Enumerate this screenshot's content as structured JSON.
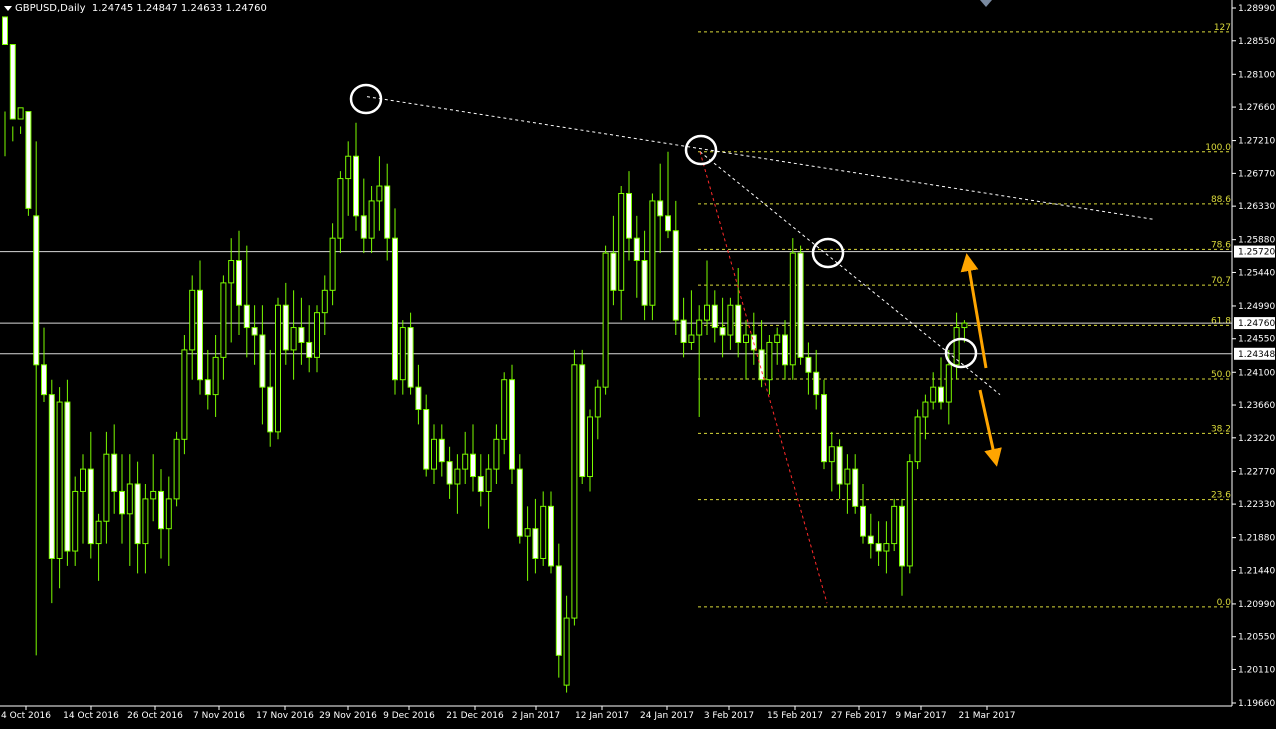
{
  "header": {
    "symbol_label": "GBPUSD,Daily",
    "ohlc": "1.24745 1.24847 1.24633 1.24760"
  },
  "colors": {
    "background": "#000000",
    "candle": "#7CFC00",
    "fib": "#d9d93a",
    "text": "#ffffff",
    "trend_red": "#ff2a2a",
    "arrow": "#ffa500",
    "price_box": "#ffffff"
  },
  "chart_data": {
    "type": "candlestick",
    "instrument": "GBPUSD",
    "timeframe": "Daily",
    "ylim": [
      1.1966,
      1.2899
    ],
    "y_ticks": [
      "1.28990",
      "1.28550",
      "1.28100",
      "1.27660",
      "1.27210",
      "1.26770",
      "1.26330",
      "1.25880",
      "1.25440",
      "1.24990",
      "1.24550",
      "1.24100",
      "1.23660",
      "1.23220",
      "1.22770",
      "1.22330",
      "1.21880",
      "1.21440",
      "1.20990",
      "1.20550",
      "1.20110",
      "1.19660"
    ],
    "x_ticks": [
      "4 Oct 2016",
      "14 Oct 2016",
      "26 Oct 2016",
      "7 Nov 2016",
      "17 Nov 2016",
      "29 Nov 2016",
      "9 Dec 2016",
      "21 Dec 2016",
      "2 Jan 2017",
      "12 Jan 2017",
      "24 Jan 2017",
      "3 Feb 2017",
      "15 Feb 2017",
      "27 Feb 2017",
      "9 Mar 2017",
      "21 Mar 2017"
    ],
    "horizontal_lines": [
      {
        "label": "1.25720",
        "price": 1.2572
      },
      {
        "label": "1.24760",
        "price": 1.2476
      },
      {
        "label": "1.24348",
        "price": 1.24348
      }
    ],
    "fibonacci": {
      "high": 1.2706,
      "low": 1.2095,
      "levels": [
        {
          "label": "127",
          "price": 1.2867
        },
        {
          "label": "100.0",
          "price": 1.2706
        },
        {
          "label": "88.6",
          "price": 1.2636
        },
        {
          "label": "78.6",
          "price": 1.2575
        },
        {
          "label": "70.7",
          "price": 1.2527
        },
        {
          "label": "61.8",
          "price": 1.2473
        },
        {
          "label": "50.0",
          "price": 1.2401
        },
        {
          "label": "38.2",
          "price": 1.2328
        },
        {
          "label": "23.6",
          "price": 1.2239
        },
        {
          "label": "0.0",
          "price": 1.2095
        }
      ]
    },
    "candles": [
      [
        1.2887,
        1.276,
        1.27,
        1.285
      ],
      [
        1.285,
        1.274,
        1.272,
        1.275
      ],
      [
        1.275,
        1.274,
        1.273,
        1.2765
      ],
      [
        1.276,
        1.275,
        1.262,
        1.263
      ],
      [
        1.262,
        1.272,
        1.203,
        1.242
      ],
      [
        1.242,
        1.247,
        1.237,
        1.238
      ],
      [
        1.238,
        1.24,
        1.21,
        1.216
      ],
      [
        1.216,
        1.239,
        1.212,
        1.237
      ],
      [
        1.237,
        1.24,
        1.215,
        1.217
      ],
      [
        1.217,
        1.227,
        1.215,
        1.225
      ],
      [
        1.225,
        1.23,
        1.218,
        1.228
      ],
      [
        1.228,
        1.233,
        1.216,
        1.218
      ],
      [
        1.218,
        1.222,
        1.213,
        1.221
      ],
      [
        1.221,
        1.233,
        1.218,
        1.23
      ],
      [
        1.23,
        1.234,
        1.222,
        1.225
      ],
      [
        1.225,
        1.23,
        1.218,
        1.222
      ],
      [
        1.222,
        1.23,
        1.215,
        1.226
      ],
      [
        1.226,
        1.229,
        1.214,
        1.218
      ],
      [
        1.218,
        1.226,
        1.214,
        1.224
      ],
      [
        1.224,
        1.23,
        1.221,
        1.225
      ],
      [
        1.225,
        1.228,
        1.216,
        1.22
      ],
      [
        1.22,
        1.227,
        1.215,
        1.224
      ],
      [
        1.224,
        1.233,
        1.223,
        1.232
      ],
      [
        1.232,
        1.246,
        1.23,
        1.244
      ],
      [
        1.244,
        1.254,
        1.24,
        1.252
      ],
      [
        1.252,
        1.256,
        1.238,
        1.24
      ],
      [
        1.24,
        1.244,
        1.236,
        1.238
      ],
      [
        1.238,
        1.246,
        1.235,
        1.243
      ],
      [
        1.243,
        1.254,
        1.24,
        1.253
      ],
      [
        1.253,
        1.259,
        1.245,
        1.256
      ],
      [
        1.256,
        1.26,
        1.246,
        1.25
      ],
      [
        1.25,
        1.258,
        1.243,
        1.247
      ],
      [
        1.247,
        1.25,
        1.242,
        1.246
      ],
      [
        1.246,
        1.25,
        1.234,
        1.239
      ],
      [
        1.239,
        1.244,
        1.231,
        1.233
      ],
      [
        1.233,
        1.251,
        1.232,
        1.25
      ],
      [
        1.25,
        1.253,
        1.242,
        1.244
      ],
      [
        1.244,
        1.252,
        1.24,
        1.247
      ],
      [
        1.247,
        1.251,
        1.242,
        1.245
      ],
      [
        1.245,
        1.25,
        1.241,
        1.243
      ],
      [
        1.243,
        1.25,
        1.241,
        1.249
      ],
      [
        1.249,
        1.254,
        1.246,
        1.252
      ],
      [
        1.252,
        1.261,
        1.25,
        1.259
      ],
      [
        1.259,
        1.268,
        1.257,
        1.267
      ],
      [
        1.267,
        1.272,
        1.262,
        1.27
      ],
      [
        1.27,
        1.2745,
        1.26,
        1.262
      ],
      [
        1.262,
        1.267,
        1.257,
        1.259
      ],
      [
        1.259,
        1.266,
        1.257,
        1.264
      ],
      [
        1.264,
        1.27,
        1.26,
        1.266
      ],
      [
        1.266,
        1.269,
        1.256,
        1.259
      ],
      [
        1.259,
        1.263,
        1.238,
        1.24
      ],
      [
        1.24,
        1.248,
        1.238,
        1.247
      ],
      [
        1.247,
        1.249,
        1.238,
        1.239
      ],
      [
        1.239,
        1.242,
        1.234,
        1.236
      ],
      [
        1.236,
        1.238,
        1.227,
        1.228
      ],
      [
        1.228,
        1.234,
        1.226,
        1.232
      ],
      [
        1.232,
        1.234,
        1.227,
        1.229
      ],
      [
        1.229,
        1.231,
        1.224,
        1.226
      ],
      [
        1.226,
        1.23,
        1.222,
        1.228
      ],
      [
        1.228,
        1.233,
        1.226,
        1.23
      ],
      [
        1.23,
        1.234,
        1.225,
        1.227
      ],
      [
        1.227,
        1.23,
        1.223,
        1.225
      ],
      [
        1.225,
        1.23,
        1.22,
        1.228
      ],
      [
        1.228,
        1.234,
        1.226,
        1.232
      ],
      [
        1.232,
        1.241,
        1.23,
        1.24
      ],
      [
        1.24,
        1.242,
        1.226,
        1.228
      ],
      [
        1.228,
        1.23,
        1.218,
        1.219
      ],
      [
        1.219,
        1.223,
        1.213,
        1.22
      ],
      [
        1.22,
        1.224,
        1.214,
        1.216
      ],
      [
        1.216,
        1.225,
        1.215,
        1.223
      ],
      [
        1.223,
        1.225,
        1.214,
        1.215
      ],
      [
        1.215,
        1.218,
        1.2,
        1.203
      ],
      [
        1.199,
        1.211,
        1.198,
        1.208
      ],
      [
        1.208,
        1.244,
        1.207,
        1.242
      ],
      [
        1.242,
        1.244,
        1.226,
        1.227
      ],
      [
        1.227,
        1.236,
        1.225,
        1.235
      ],
      [
        1.235,
        1.24,
        1.232,
        1.239
      ],
      [
        1.239,
        1.258,
        1.238,
        1.257
      ],
      [
        1.257,
        1.262,
        1.25,
        1.252
      ],
      [
        1.252,
        1.266,
        1.248,
        1.265
      ],
      [
        1.265,
        1.268,
        1.256,
        1.259
      ],
      [
        1.259,
        1.262,
        1.251,
        1.256
      ],
      [
        1.256,
        1.26,
        1.248,
        1.25
      ],
      [
        1.25,
        1.265,
        1.248,
        1.264
      ],
      [
        1.264,
        1.269,
        1.257,
        1.262
      ],
      [
        1.262,
        1.2706,
        1.259,
        1.26
      ],
      [
        1.26,
        1.264,
        1.246,
        1.248
      ],
      [
        1.248,
        1.251,
        1.243,
        1.245
      ],
      [
        1.245,
        1.252,
        1.244,
        1.246
      ],
      [
        1.246,
        1.25,
        1.235,
        1.248
      ],
      [
        1.248,
        1.256,
        1.246,
        1.25
      ],
      [
        1.25,
        1.252,
        1.245,
        1.247
      ],
      [
        1.247,
        1.251,
        1.243,
        1.246
      ],
      [
        1.246,
        1.251,
        1.244,
        1.25
      ],
      [
        1.25,
        1.255,
        1.243,
        1.245
      ],
      [
        1.245,
        1.248,
        1.24,
        1.246
      ],
      [
        1.246,
        1.249,
        1.242,
        1.244
      ],
      [
        1.244,
        1.248,
        1.239,
        1.24
      ],
      [
        1.24,
        1.246,
        1.238,
        1.245
      ],
      [
        1.245,
        1.247,
        1.242,
        1.246
      ],
      [
        1.246,
        1.248,
        1.24,
        1.242
      ],
      [
        1.242,
        1.259,
        1.24,
        1.257
      ],
      [
        1.257,
        1.258,
        1.242,
        1.243
      ],
      [
        1.243,
        1.245,
        1.238,
        1.241
      ],
      [
        1.241,
        1.244,
        1.236,
        1.238
      ],
      [
        1.238,
        1.24,
        1.228,
        1.229
      ],
      [
        1.229,
        1.233,
        1.225,
        1.231
      ],
      [
        1.231,
        1.232,
        1.224,
        1.226
      ],
      [
        1.226,
        1.23,
        1.222,
        1.228
      ],
      [
        1.228,
        1.23,
        1.222,
        1.223
      ],
      [
        1.223,
        1.226,
        1.218,
        1.219
      ],
      [
        1.219,
        1.222,
        1.216,
        1.218
      ],
      [
        1.218,
        1.221,
        1.215,
        1.217
      ],
      [
        1.217,
        1.221,
        1.214,
        1.218
      ],
      [
        1.218,
        1.224,
        1.217,
        1.223
      ],
      [
        1.223,
        1.224,
        1.211,
        1.215
      ],
      [
        1.215,
        1.23,
        1.214,
        1.229
      ],
      [
        1.229,
        1.236,
        1.228,
        1.235
      ],
      [
        1.235,
        1.238,
        1.232,
        1.237
      ],
      [
        1.237,
        1.241,
        1.236,
        1.239
      ],
      [
        1.239,
        1.243,
        1.236,
        1.237
      ],
      [
        1.237,
        1.244,
        1.234,
        1.242
      ],
      [
        1.242,
        1.249,
        1.24,
        1.247
      ],
      [
        1.247,
        1.248,
        1.245,
        1.2476
      ]
    ]
  }
}
